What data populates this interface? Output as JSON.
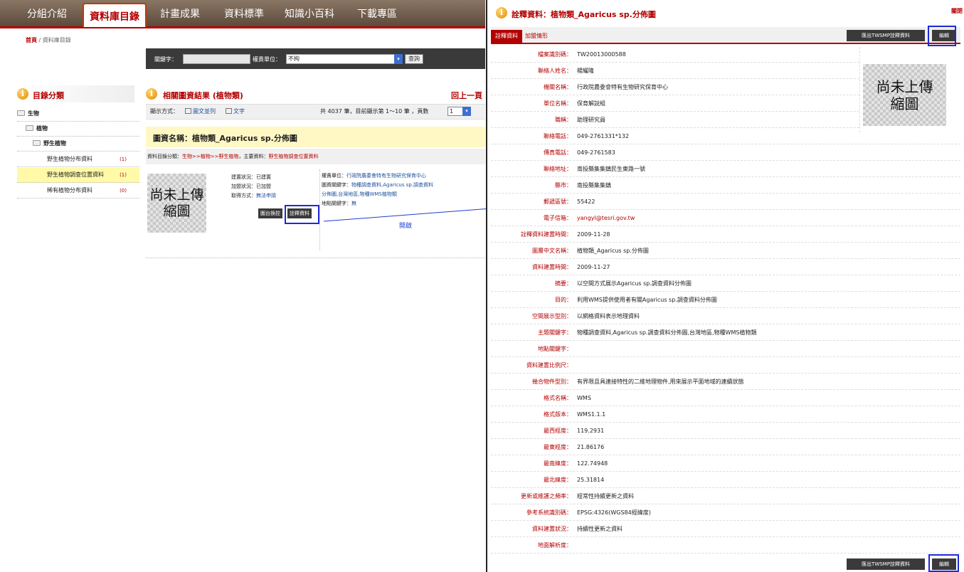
{
  "nav": {
    "tabs": [
      "分組介紹",
      "資料庫目錄",
      "計畫成果",
      "資料標準",
      "知識小百科",
      "下載專區"
    ]
  },
  "breadcrumb": {
    "home": "首頁",
    "sep": " / ",
    "current": "資料庫目錄"
  },
  "search": {
    "keyword_label": "關鍵字：",
    "keyword_value": "",
    "unit_label": "權責單位：",
    "unit_value": "不拘",
    "button": "查詢"
  },
  "sidebar": {
    "title": "目錄分類",
    "items": [
      {
        "label": "生物",
        "count": ""
      },
      {
        "label": "植物",
        "count": ""
      },
      {
        "label": "野生植物",
        "count": ""
      },
      {
        "label": "野生植物分布資料",
        "count": "(1)"
      },
      {
        "label": "野生植物調查位置資料",
        "count": "(1)"
      },
      {
        "label": "稀有植物分布資料",
        "count": "(0)"
      }
    ]
  },
  "results": {
    "title": "相關圖資結果 (植物類)",
    "back_link": "回上一頁",
    "display_label": "顯示方式：",
    "view_grid": "圖文並列",
    "view_text": "文字",
    "summary": "共 4037 筆，目前顯示第 1～10 筆 ，頁數",
    "page": "1",
    "item": {
      "name": "圖資名稱：植物類_Agaricus sp.分佈圖",
      "cat_label": "資料目錄分類：",
      "cat_path": "生物>>植物>>野生植物",
      "cat_main_label": "，主要資料：",
      "cat_main": "野生植物調查位置資料",
      "thumb_line1": "尚未上傳",
      "thumb_line2": "縮圖",
      "build_label": "建置狀況：",
      "build_value": "已建置",
      "join_label": "加盟狀況：",
      "join_value": "已加盟",
      "obtain_label": "取得方式：",
      "obtain_value": "無法申請",
      "btn_import": "圖台換控",
      "btn_meta": "詮釋資料",
      "agency_label": "權責單位：",
      "agency_value": "行政院農委會特有生物研究保育中心",
      "kw_label": "圖資關鍵字：",
      "kw_value1": "物種調查資料,Agaricus sp.調查資料",
      "kw_value2": "分佈圖,台灣地區,物種WMS植物類",
      "loc_label": "地點關鍵字：",
      "loc_value": "無"
    }
  },
  "annotation": {
    "open_label": "開啟"
  },
  "metadata_panel": {
    "title": "詮釋資料：植物類_Agaricus sp.分佈圖",
    "corner": "關閉",
    "tabs": [
      "詮釋資料",
      "加盟情形"
    ],
    "export_button": "匯出TWSMP詮釋資料",
    "edit_button": "編輯",
    "thumb_line1": "尚未上傳",
    "thumb_line2": "縮圖",
    "fields": [
      {
        "label": "檔案識別碼：",
        "value": "TW20013000588"
      },
      {
        "label": "聯絡人姓名：",
        "value": "楊耀隆"
      },
      {
        "label": "機關名稱：",
        "value": "行政院農委會特有生物研究保育中心"
      },
      {
        "label": "單位名稱：",
        "value": "保育解說組"
      },
      {
        "label": "職稱：",
        "value": "助理研究員"
      },
      {
        "label": "聯絡電話：",
        "value": "049-2761331*132"
      },
      {
        "label": "傳真電話：",
        "value": "049-2761583"
      },
      {
        "label": "聯絡地址：",
        "value": "南投縣集集鎮民生東路一號"
      },
      {
        "label": "縣市：",
        "value": "南投縣集集鎮"
      },
      {
        "label": "郵遞區號：",
        "value": "55422"
      },
      {
        "label": "電子信箱：",
        "value": "yangyl@tesri.gov.tw"
      },
      {
        "label": "詮釋資料建置時間：",
        "value": "2009-11-28"
      },
      {
        "label": "圖層中文名稱：",
        "value": "植物類_Agaricus sp.分佈圖"
      },
      {
        "label": "資料建置時間：",
        "value": "2009-11-27"
      },
      {
        "label": "摘要：",
        "value": "以空間方式展示Agaricus sp.調查資料分佈圖"
      },
      {
        "label": "目的：",
        "value": "利用WMS提供使用者有關Agaricus sp.調查資料分佈圖"
      },
      {
        "label": "空間展示型別：",
        "value": "以網格資料表示地理資料"
      },
      {
        "label": "主題關鍵字：",
        "value": "物種調查資料,Agaricus sp.調查資料分佈圖,台灣地區,物種WMS植物類"
      },
      {
        "label": "地點關鍵字：",
        "value": ""
      },
      {
        "label": "資料建置比例尺：",
        "value": ""
      },
      {
        "label": "幾合物件型別：",
        "value": "有界限且具連接特性的二維地理物件,用來展示平面地域的連續狀態"
      },
      {
        "label": "格式名稱：",
        "value": "WMS"
      },
      {
        "label": "格式版本：",
        "value": "WMS1.1.1"
      },
      {
        "label": "最西經度：",
        "value": "119.2931"
      },
      {
        "label": "最東經度：",
        "value": "21.86176"
      },
      {
        "label": "最南緯度：",
        "value": "122.74948"
      },
      {
        "label": "最北緯度：",
        "value": "25.31814"
      },
      {
        "label": "更新或維護之頻率：",
        "value": "經常性持續更新之資料"
      },
      {
        "label": "參考系統識別碼：",
        "value": "EPSG:4326(WGS84經緯度)"
      },
      {
        "label": "資料建置狀況：",
        "value": "持續性更新之資料"
      },
      {
        "label": "地面解析度：",
        "value": ""
      }
    ]
  }
}
